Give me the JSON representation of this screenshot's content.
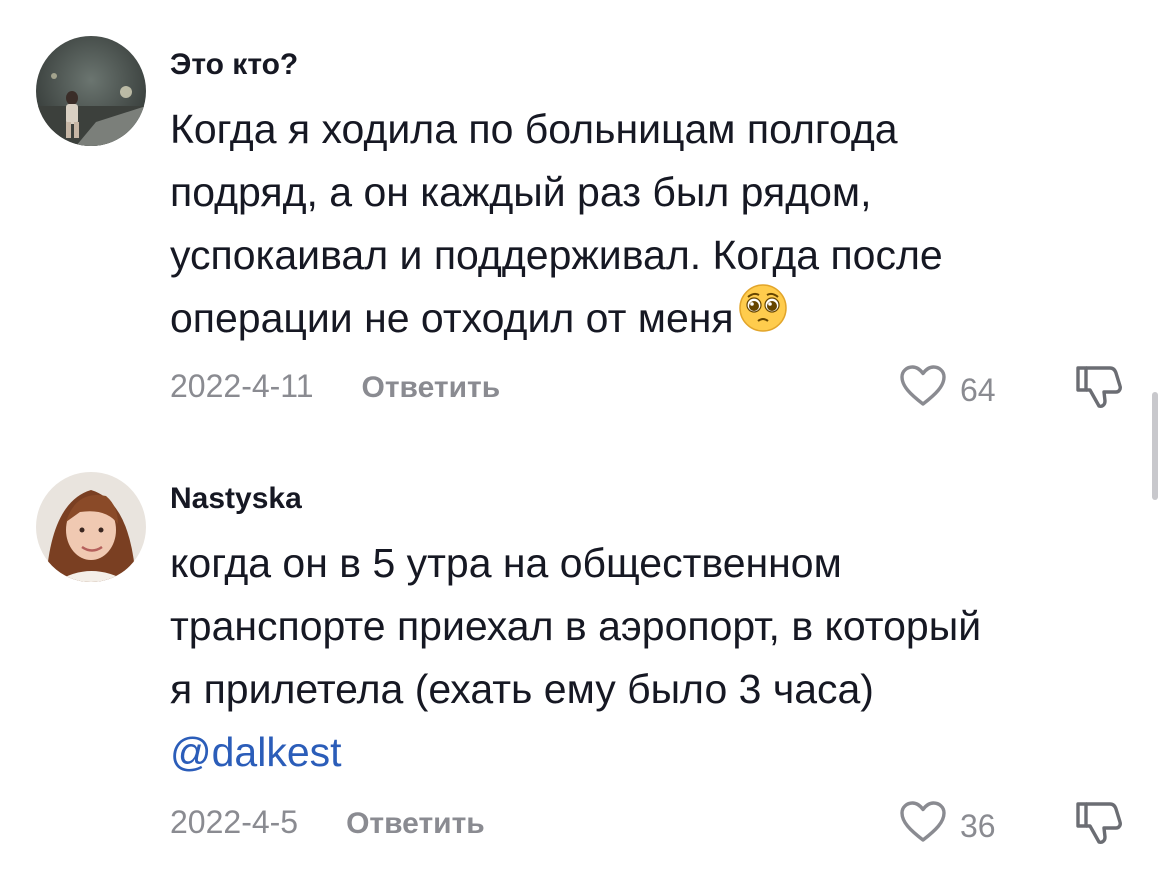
{
  "comments": [
    {
      "username": "Это кто?",
      "lines": [
        "Когда я ходила по больницам полгода",
        "подряд, а он каждый раз был рядом,",
        "успокаивал и поддерживал. Когда после",
        "операции не отходил от меня"
      ],
      "emoji": "pleading-face",
      "date": "2022-4-11",
      "reply_label": "Ответить",
      "likes": "64",
      "avatar": "night-street-photo"
    },
    {
      "username": "Nastyska",
      "lines": [
        "когда он в 5 утра на общественном",
        "транспорте приехал в аэропорт, в который",
        "я прилетела (ехать ему было 3 часа)"
      ],
      "mention": "@dalkest",
      "date": "2022-4-5",
      "reply_label": "Ответить",
      "likes": "36",
      "avatar": "girl-portrait-photo"
    }
  ],
  "colors": {
    "text": "#161823",
    "muted": "#8a8b91",
    "mention": "#2b5db9"
  }
}
